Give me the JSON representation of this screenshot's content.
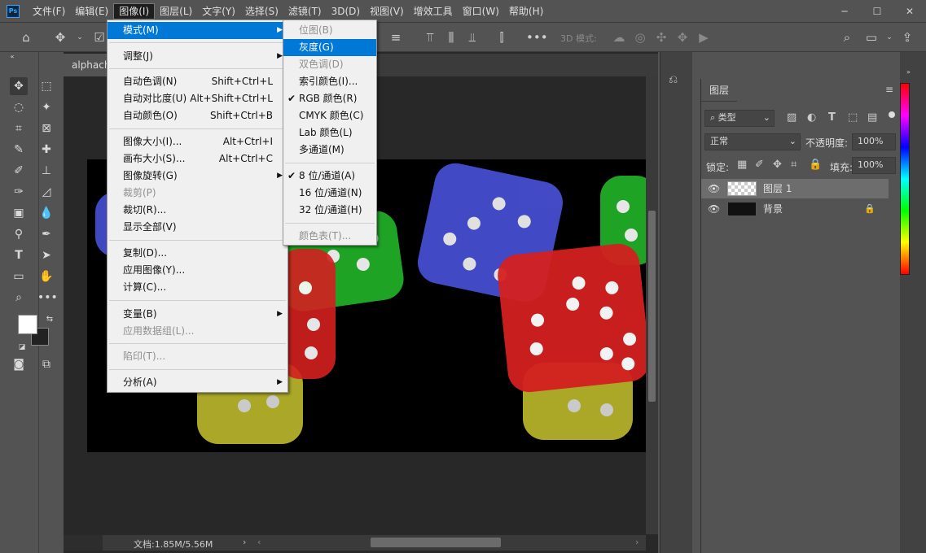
{
  "menubar": {
    "items": [
      "文件(F)",
      "编辑(E)",
      "图像(I)",
      "图层(L)",
      "文字(Y)",
      "选择(S)",
      "滤镜(T)",
      "3D(D)",
      "视图(V)",
      "增效工具",
      "窗口(W)",
      "帮助(H)"
    ],
    "logo": "Ps"
  },
  "options": {
    "mode3d_label": "3D 模式:"
  },
  "document": {
    "tab_title": "alphacha",
    "status": "文档:1.85M/5.56M"
  },
  "image_menu": {
    "mode": "模式(M)",
    "adjust": "调整(J)",
    "auto_tone": "自动色调(N)",
    "auto_tone_sc": "Shift+Ctrl+L",
    "auto_contrast": "自动对比度(U)",
    "auto_contrast_sc": "Alt+Shift+Ctrl+L",
    "auto_color": "自动颜色(O)",
    "auto_color_sc": "Shift+Ctrl+B",
    "image_size": "图像大小(I)...",
    "image_size_sc": "Alt+Ctrl+I",
    "canvas_size": "画布大小(S)...",
    "canvas_size_sc": "Alt+Ctrl+C",
    "rotation": "图像旋转(G)",
    "crop": "裁剪(P)",
    "trim": "裁切(R)...",
    "reveal_all": "显示全部(V)",
    "duplicate": "复制(D)...",
    "apply_image": "应用图像(Y)...",
    "calculations": "计算(C)...",
    "variables": "变量(B)",
    "apply_dataset": "应用数据组(L)...",
    "trap": "陷印(T)...",
    "analysis": "分析(A)"
  },
  "mode_menu": {
    "bitmap": "位图(B)",
    "grayscale": "灰度(G)",
    "duotone": "双色调(D)",
    "indexed": "索引颜色(I)...",
    "rgb": "RGB 颜色(R)",
    "cmyk": "CMYK 颜色(C)",
    "lab": "Lab 颜色(L)",
    "multichannel": "多通道(M)",
    "bit8": "8 位/通道(A)",
    "bit16": "16 位/通道(N)",
    "bit32": "32 位/通道(H)",
    "color_table": "颜色表(T)...",
    "checkmark": "✔"
  },
  "layers_panel": {
    "tab": "图层",
    "filter_kind": "类型",
    "blend_mode": "正常",
    "opacity_label": "不透明度:",
    "opacity_value": "100%",
    "lock_label": "锁定:",
    "fill_label": "填充:",
    "fill_value": "100%",
    "layers": [
      {
        "name": "图层 1",
        "selected": true
      },
      {
        "name": "背景",
        "locked": true
      }
    ]
  },
  "colors": {
    "accent": "#0078d7",
    "die_blue": "#4b55e0",
    "die_red": "#d42020",
    "die_green": "#22b52a",
    "die_yellow": "#c9c630"
  }
}
